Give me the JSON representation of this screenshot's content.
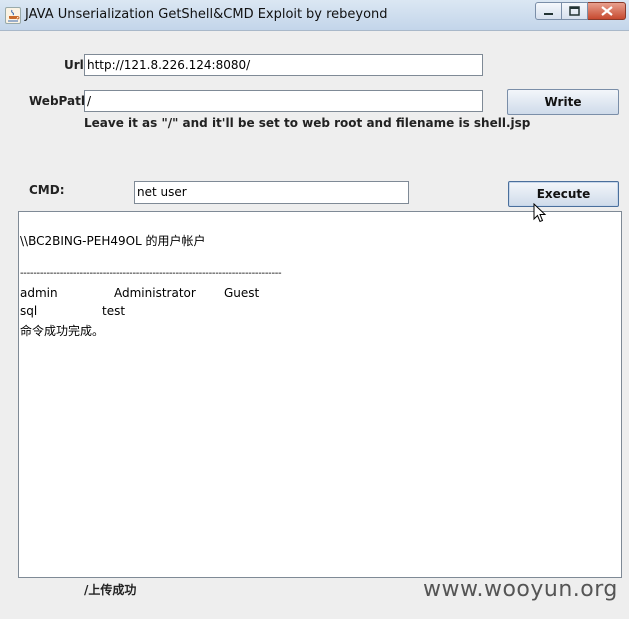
{
  "window": {
    "title": "JAVA Unserialization GetShell&CMD Exploit",
    "author": "by rebeyond"
  },
  "form": {
    "url_label": "Url:",
    "url_value": "http://121.8.226.124:8080/",
    "webpath_label": "WebPath:",
    "webpath_value": "/",
    "write_label": "Write",
    "hint": "Leave it as \"/\" and it'll be set to web root and filename is shell.jsp",
    "cmd_label": "CMD:",
    "cmd_value": "net user",
    "execute_label": "Execute"
  },
  "output": {
    "header": "\\\\BC2BING-PEH49OL 的用户帐户",
    "separator": "-------------------------------------------------------------------------------",
    "rows": [
      [
        "admin",
        "Administrator",
        "Guest"
      ],
      [
        "sql",
        "test",
        ""
      ]
    ],
    "footer": "命令成功完成。"
  },
  "status": "/上传成功",
  "watermark": "www.wooyun.org"
}
